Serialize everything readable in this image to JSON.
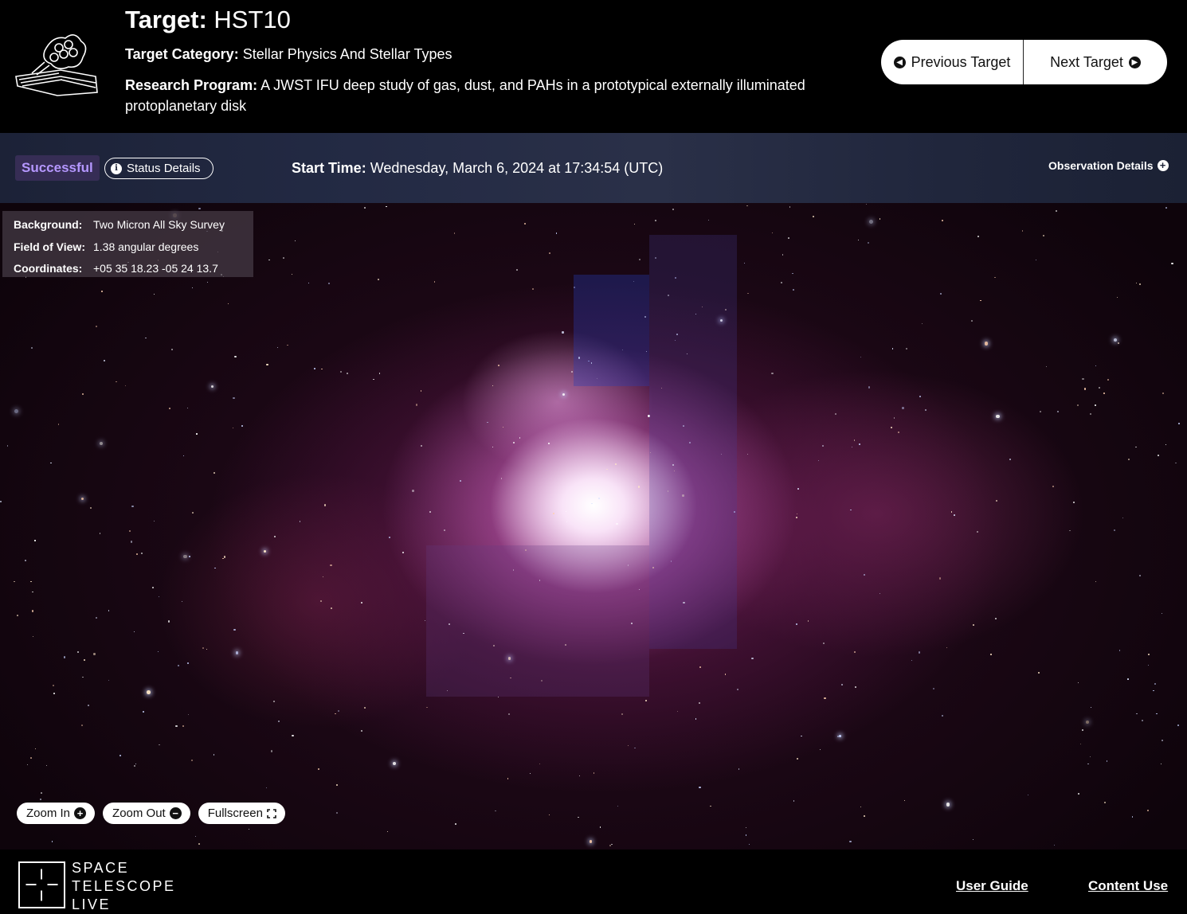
{
  "header": {
    "target_label": "Target:",
    "target_value": "HST10",
    "category_label": "Target Category:",
    "category_value": "Stellar Physics And Stellar Types",
    "program_label": "Research Program:",
    "program_value": "A JWST IFU deep study of gas, dust, and PAHs in a prototypical externally illuminated protoplanetary disk",
    "prev_label": "Previous Target",
    "next_label": "Next Target"
  },
  "status": {
    "badge": "Successful",
    "details_label": "Status Details",
    "start_label": "Start Time:",
    "start_value": "Wednesday, March 6, 2024 at 17:34:54 (UTC)",
    "obs_details_label": "Observation Details"
  },
  "sky_info": {
    "background_label": "Background:",
    "background_value": "Two Micron All Sky Survey",
    "fov_label": "Field of View:",
    "fov_value": "1.38 angular degrees",
    "coords_label": "Coordinates:",
    "coords_value": "+05 35 18.23 -05 24 13.7"
  },
  "controls": {
    "zoom_in": "Zoom In",
    "zoom_out": "Zoom Out",
    "fullscreen": "Fullscreen"
  },
  "footer": {
    "logo_line1": "SPACE",
    "logo_line2": "TELESCOPE",
    "logo_line3": "LIVE",
    "user_guide": "User Guide",
    "content_use": "Content Use"
  },
  "colors": {
    "status_accent": "#b597ff",
    "status_bg": "#362d55",
    "bar_bg": "#232a44"
  },
  "icons": [
    "telescope-icon",
    "arrow-left-icon",
    "arrow-right-icon",
    "info-icon",
    "plus-circle-icon",
    "minus-circle-icon",
    "fullscreen-icon",
    "stsci-logo-icon"
  ]
}
